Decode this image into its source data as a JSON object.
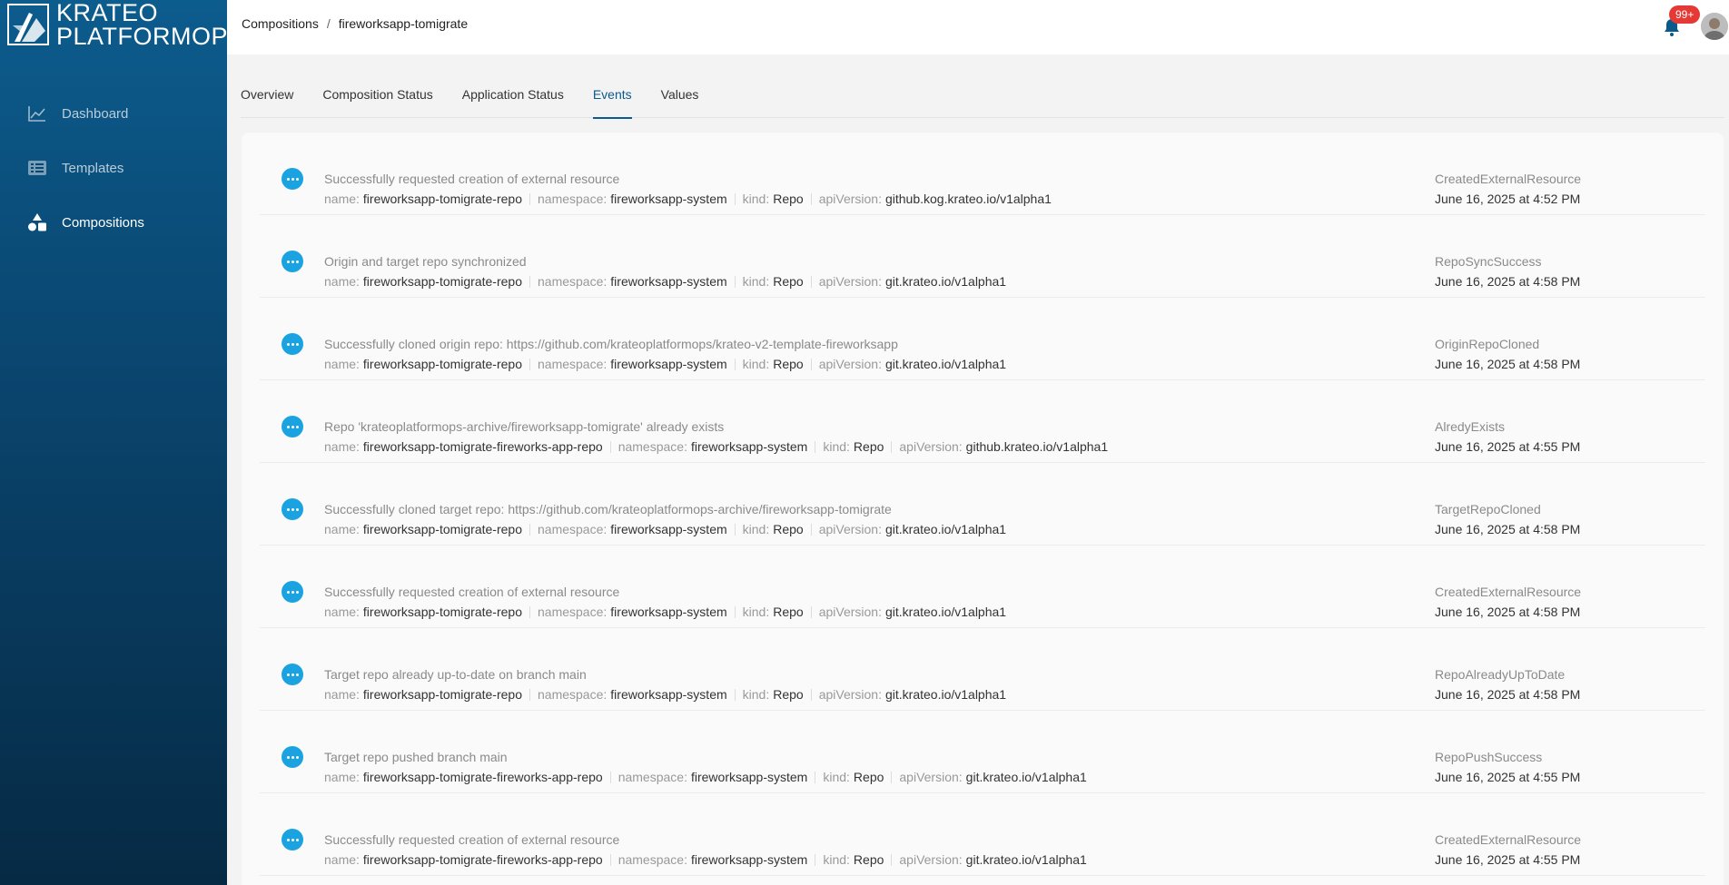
{
  "brand": {
    "line1": "KRATEO",
    "line2": "PLATFORMOPS"
  },
  "sidebar": {
    "items": [
      {
        "label": "Dashboard",
        "icon": "chart-line-icon",
        "active": false
      },
      {
        "label": "Templates",
        "icon": "list-icon",
        "active": false
      },
      {
        "label": "Compositions",
        "icon": "shapes-icon",
        "active": true
      }
    ]
  },
  "header": {
    "breadcrumb": [
      "Compositions",
      "fireworksapp-tomigrate"
    ],
    "notifications_badge": "99+"
  },
  "tabs": [
    {
      "label": "Overview",
      "active": false
    },
    {
      "label": "Composition Status",
      "active": false
    },
    {
      "label": "Application Status",
      "active": false
    },
    {
      "label": "Events",
      "active": true
    },
    {
      "label": "Values",
      "active": false
    }
  ],
  "meta_keys": {
    "name": "name:",
    "namespace": "namespace:",
    "kind": "kind:",
    "apiVersion": "apiVersion:"
  },
  "events": [
    {
      "message": "Successfully requested creation of external resource",
      "name": "fireworksapp-tomigrate-repo",
      "namespace": "fireworksapp-system",
      "kind": "Repo",
      "apiVersion": "github.kog.krateo.io/v1alpha1",
      "reason": "CreatedExternalResource",
      "time": "June 16, 2025 at 4:52 PM"
    },
    {
      "message": "Origin and target repo synchronized",
      "name": "fireworksapp-tomigrate-repo",
      "namespace": "fireworksapp-system",
      "kind": "Repo",
      "apiVersion": "git.krateo.io/v1alpha1",
      "reason": "RepoSyncSuccess",
      "time": "June 16, 2025 at 4:58 PM"
    },
    {
      "message": "Successfully cloned origin repo: https://github.com/krateoplatformops/krateo-v2-template-fireworksapp",
      "name": "fireworksapp-tomigrate-repo",
      "namespace": "fireworksapp-system",
      "kind": "Repo",
      "apiVersion": "git.krateo.io/v1alpha1",
      "reason": "OriginRepoCloned",
      "time": "June 16, 2025 at 4:58 PM"
    },
    {
      "message": "Repo 'krateoplatformops-archive/fireworksapp-tomigrate' already exists",
      "name": "fireworksapp-tomigrate-fireworks-app-repo",
      "namespace": "fireworksapp-system",
      "kind": "Repo",
      "apiVersion": "github.krateo.io/v1alpha1",
      "reason": "AlredyExists",
      "time": "June 16, 2025 at 4:55 PM"
    },
    {
      "message": "Successfully cloned target repo: https://github.com/krateoplatformops-archive/fireworksapp-tomigrate",
      "name": "fireworksapp-tomigrate-repo",
      "namespace": "fireworksapp-system",
      "kind": "Repo",
      "apiVersion": "git.krateo.io/v1alpha1",
      "reason": "TargetRepoCloned",
      "time": "June 16, 2025 at 4:58 PM"
    },
    {
      "message": "Successfully requested creation of external resource",
      "name": "fireworksapp-tomigrate-repo",
      "namespace": "fireworksapp-system",
      "kind": "Repo",
      "apiVersion": "git.krateo.io/v1alpha1",
      "reason": "CreatedExternalResource",
      "time": "June 16, 2025 at 4:58 PM"
    },
    {
      "message": "Target repo already up-to-date on branch main",
      "name": "fireworksapp-tomigrate-repo",
      "namespace": "fireworksapp-system",
      "kind": "Repo",
      "apiVersion": "git.krateo.io/v1alpha1",
      "reason": "RepoAlreadyUpToDate",
      "time": "June 16, 2025 at 4:58 PM"
    },
    {
      "message": "Target repo pushed branch main",
      "name": "fireworksapp-tomigrate-fireworks-app-repo",
      "namespace": "fireworksapp-system",
      "kind": "Repo",
      "apiVersion": "git.krateo.io/v1alpha1",
      "reason": "RepoPushSuccess",
      "time": "June 16, 2025 at 4:55 PM"
    },
    {
      "message": "Successfully requested creation of external resource",
      "name": "fireworksapp-tomigrate-fireworks-app-repo",
      "namespace": "fireworksapp-system",
      "kind": "Repo",
      "apiVersion": "git.krateo.io/v1alpha1",
      "reason": "CreatedExternalResource",
      "time": "June 16, 2025 at 4:55 PM"
    }
  ],
  "colors": {
    "sidebar_top": "#0c5c8d",
    "sidebar_bottom": "#062a44",
    "accent": "#0b5a8c",
    "event_button": "#1aa3e0",
    "badge": "#e53935"
  }
}
